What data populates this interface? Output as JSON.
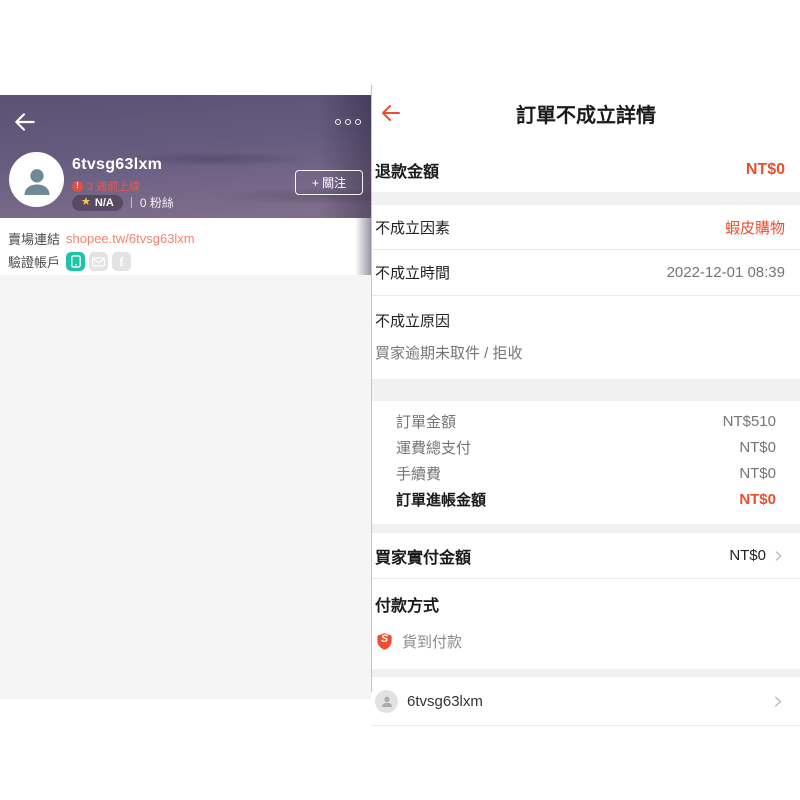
{
  "colors": {
    "accent": "#ee4d2d",
    "link": "#f4846f",
    "teal": "#1ec4a8",
    "header_purple": "#655b7e"
  },
  "left_panel": {
    "username": "6tvsg63lxm",
    "last_online": "3 週前上線",
    "rating_star": "★",
    "rating": "N/A",
    "followers": "0 粉絲",
    "follow_button": "+ 關注",
    "shop_link_label": "賣場連結",
    "shop_link": "shopee.tw/6tvsg63lxm",
    "verified_label": "驗證帳戶"
  },
  "right_panel": {
    "title": "訂單不成立詳情",
    "refund": {
      "label": "退款金額",
      "value": "NT$0"
    },
    "rows": [
      {
        "label": "不成立因素",
        "value": "蝦皮購物"
      },
      {
        "label": "不成立時間",
        "value": "2022-12-01 08:39"
      }
    ],
    "reason": {
      "label": "不成立原因",
      "value": "買家逾期未取件 / 拒收"
    },
    "amounts": [
      {
        "label": "訂單金額",
        "value": "NT$510"
      },
      {
        "label": "運費總支付",
        "value": "NT$0"
      },
      {
        "label": "手續費",
        "value": "NT$0"
      },
      {
        "label": "訂單進帳金額",
        "value": "NT$0"
      }
    ],
    "buyer_paid": {
      "label": "買家實付金額",
      "value": "NT$0"
    },
    "payment": {
      "label": "付款方式",
      "method": "貨到付款",
      "shield_letter": "S"
    },
    "seller": {
      "name": "6tvsg63lxm"
    }
  }
}
